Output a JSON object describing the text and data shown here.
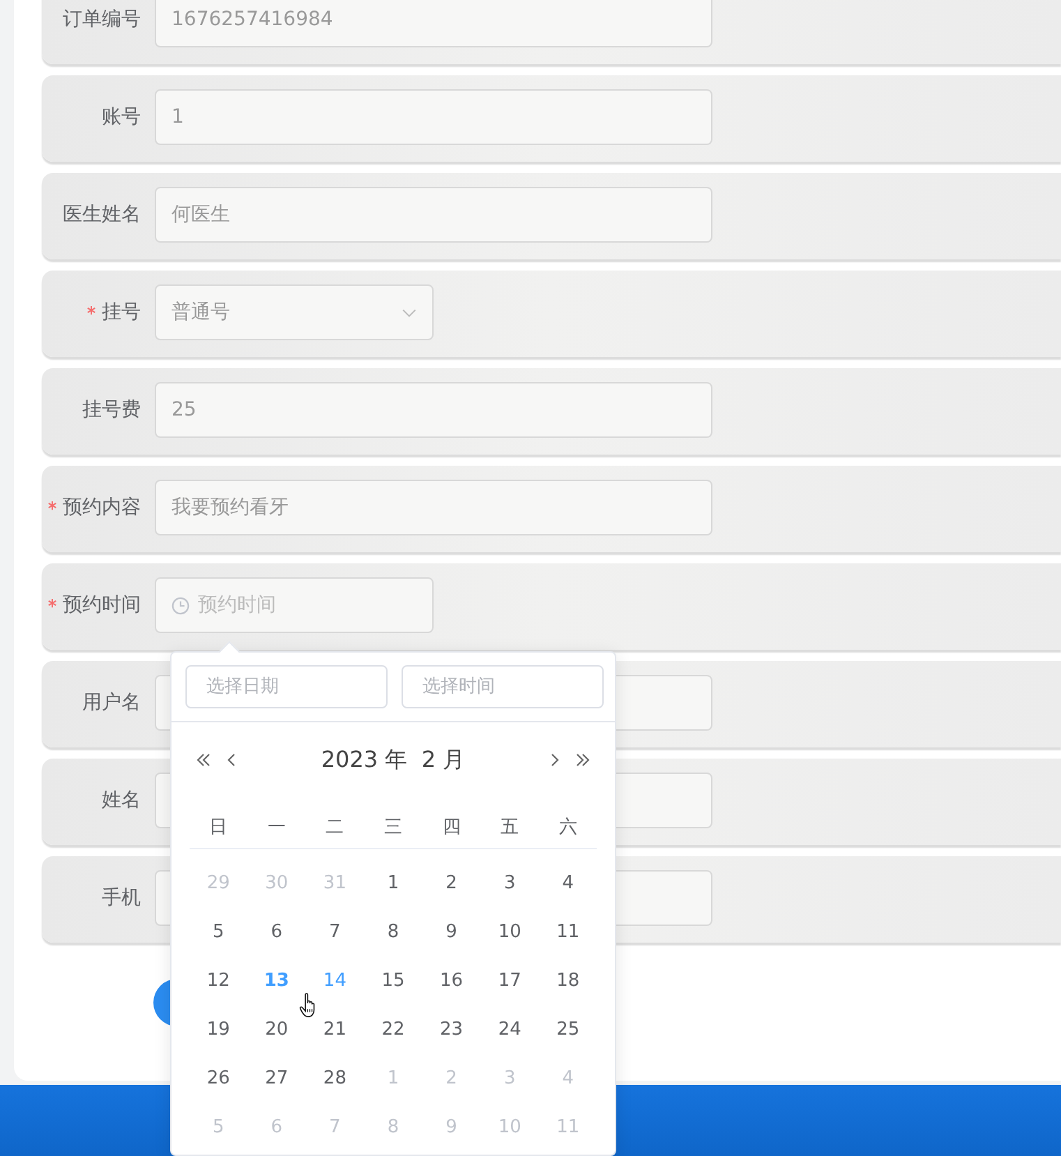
{
  "form": {
    "fields": [
      {
        "label": "订单编号",
        "required": false,
        "kind": "text",
        "value": "1676257416984"
      },
      {
        "label": "账号",
        "required": false,
        "kind": "text",
        "value": "1"
      },
      {
        "label": "医生姓名",
        "required": false,
        "kind": "text",
        "value": "何医生"
      },
      {
        "label": "挂号",
        "required": true,
        "kind": "select",
        "value": "普通号"
      },
      {
        "label": "挂号费",
        "required": false,
        "kind": "text",
        "value": "25"
      },
      {
        "label": "预约内容",
        "required": true,
        "kind": "text",
        "value": "我要预约看牙"
      },
      {
        "label": "预约时间",
        "required": true,
        "kind": "datetime",
        "placeholder": "预约时间"
      },
      {
        "label": "用户名",
        "required": false,
        "kind": "text"
      },
      {
        "label": "姓名",
        "required": false,
        "kind": "text"
      },
      {
        "label": "手机",
        "required": false,
        "kind": "text"
      }
    ]
  },
  "date_picker": {
    "date_placeholder": "选择日期",
    "time_placeholder": "选择时间",
    "title": "2023 年  2 月",
    "weekdays": [
      "日",
      "一",
      "二",
      "三",
      "四",
      "五",
      "六"
    ],
    "weeks": [
      [
        {
          "day": "29",
          "kind": "muted"
        },
        {
          "day": "30",
          "kind": "muted"
        },
        {
          "day": "31",
          "kind": "muted"
        },
        {
          "day": "1",
          "kind": "normal"
        },
        {
          "day": "2",
          "kind": "normal"
        },
        {
          "day": "3",
          "kind": "normal"
        },
        {
          "day": "4",
          "kind": "normal"
        }
      ],
      [
        {
          "day": "5",
          "kind": "normal"
        },
        {
          "day": "6",
          "kind": "normal"
        },
        {
          "day": "7",
          "kind": "normal"
        },
        {
          "day": "8",
          "kind": "normal"
        },
        {
          "day": "9",
          "kind": "normal"
        },
        {
          "day": "10",
          "kind": "normal"
        },
        {
          "day": "11",
          "kind": "normal"
        }
      ],
      [
        {
          "day": "12",
          "kind": "normal"
        },
        {
          "day": "13",
          "kind": "today"
        },
        {
          "day": "14",
          "kind": "hover"
        },
        {
          "day": "15",
          "kind": "normal"
        },
        {
          "day": "16",
          "kind": "normal"
        },
        {
          "day": "17",
          "kind": "normal"
        },
        {
          "day": "18",
          "kind": "normal"
        }
      ],
      [
        {
          "day": "19",
          "kind": "normal"
        },
        {
          "day": "20",
          "kind": "normal"
        },
        {
          "day": "21",
          "kind": "normal"
        },
        {
          "day": "22",
          "kind": "normal"
        },
        {
          "day": "23",
          "kind": "normal"
        },
        {
          "day": "24",
          "kind": "normal"
        },
        {
          "day": "25",
          "kind": "normal"
        }
      ],
      [
        {
          "day": "26",
          "kind": "normal"
        },
        {
          "day": "27",
          "kind": "normal"
        },
        {
          "day": "28",
          "kind": "normal"
        },
        {
          "day": "1",
          "kind": "muted"
        },
        {
          "day": "2",
          "kind": "muted"
        },
        {
          "day": "3",
          "kind": "muted"
        },
        {
          "day": "4",
          "kind": "muted"
        }
      ],
      [
        {
          "day": "5",
          "kind": "muted"
        },
        {
          "day": "6",
          "kind": "muted"
        },
        {
          "day": "7",
          "kind": "muted"
        },
        {
          "day": "8",
          "kind": "muted"
        },
        {
          "day": "9",
          "kind": "muted"
        },
        {
          "day": "10",
          "kind": "muted"
        },
        {
          "day": "11",
          "kind": "muted"
        }
      ]
    ]
  }
}
